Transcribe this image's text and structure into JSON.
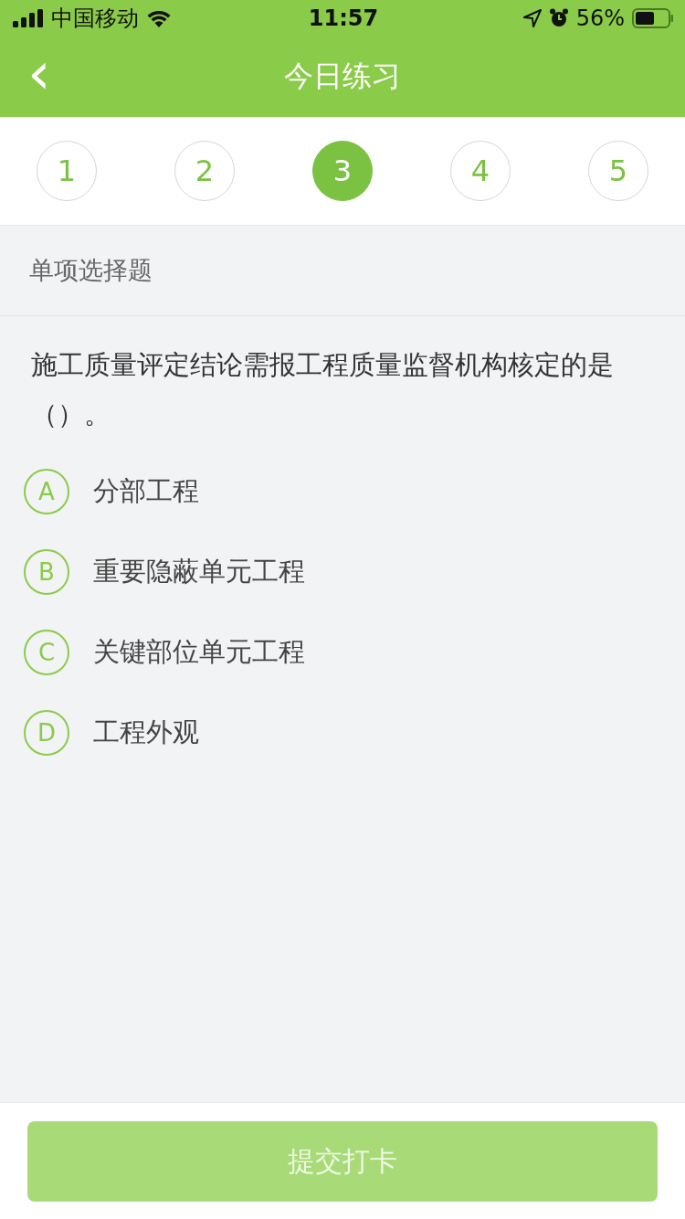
{
  "status_bar": {
    "carrier": "中国移动",
    "time": "11:57",
    "battery": "56%"
  },
  "nav": {
    "back": "‹",
    "title": "今日练习"
  },
  "steps": [
    {
      "label": "1",
      "selected": false
    },
    {
      "label": "2",
      "selected": false
    },
    {
      "label": "3",
      "selected": true
    },
    {
      "label": "4",
      "selected": false
    },
    {
      "label": "5",
      "selected": false
    }
  ],
  "section": "单项选择题",
  "question": "施工质量评定结论需报工程质量监督机构核定的是（）。",
  "options": [
    {
      "letter": "A",
      "text": "分部工程",
      "selected": false
    },
    {
      "letter": "B",
      "text": "重要隐蔽单元工程",
      "selected": false
    },
    {
      "letter": "C",
      "text": "关键部位单元工程",
      "selected": false
    },
    {
      "letter": "D",
      "text": "工程外观",
      "selected": false
    }
  ],
  "submit": {
    "label": "提交打卡",
    "disabled": true
  }
}
